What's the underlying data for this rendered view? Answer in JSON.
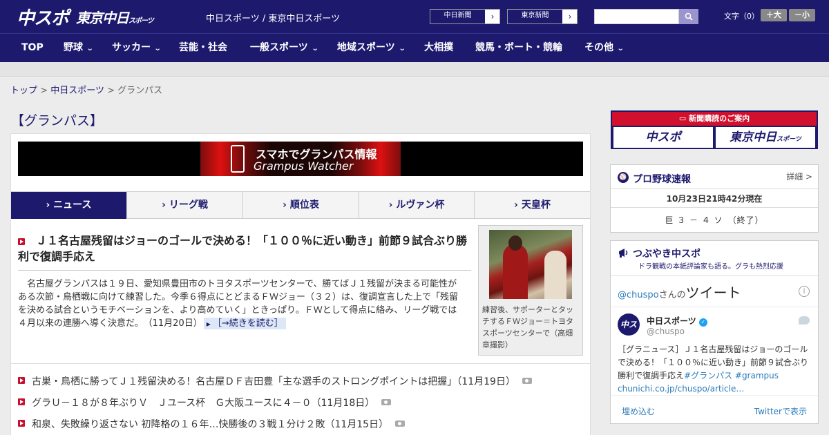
{
  "header": {
    "logo_main": "中スポ",
    "logo_tokyo": "東京中日",
    "logo_tokyo_small": "スポーツ",
    "site_links": "中日スポーツ / 東京中日スポーツ",
    "ext_links": [
      {
        "label": "中日新聞",
        "arrow": "›"
      },
      {
        "label": "東京新聞",
        "arrow": "›"
      }
    ],
    "search": {
      "placeholder": "",
      "button_icon": "search-icon"
    },
    "font_size_label": "文字（0）",
    "font_bigger": "＋大",
    "font_smaller": "－小"
  },
  "nav": {
    "items": [
      {
        "label": "TOP",
        "dropdown": false
      },
      {
        "label": "野球",
        "dropdown": true
      },
      {
        "label": "サッカー",
        "dropdown": true
      },
      {
        "label": "芸能・社会",
        "dropdown": false
      },
      {
        "label": "一般スポーツ",
        "dropdown": true
      },
      {
        "label": "地域スポーツ",
        "dropdown": true
      },
      {
        "label": "大相撲",
        "dropdown": false
      },
      {
        "label": "競馬・ボート・競輪",
        "dropdown": false
      },
      {
        "label": "その他",
        "dropdown": true
      }
    ],
    "chevron": "⌄"
  },
  "breadcrumb": {
    "home": "トップ",
    "sep": ">",
    "section": "中日スポーツ",
    "current": "グランパス"
  },
  "page_title": "【グランパス】",
  "banner": {
    "line1": "スマホでグランパス情報",
    "line2": "Grampus Watcher"
  },
  "tabs": [
    {
      "label": "ニュース",
      "active": true
    },
    {
      "label": "リーグ戦",
      "active": false
    },
    {
      "label": "順位表",
      "active": false
    },
    {
      "label": "ルヴァン杯",
      "active": false
    },
    {
      "label": "天皇杯",
      "active": false
    }
  ],
  "tab_prefix": "› ",
  "lead_article": {
    "headline": "Ｊ１名古屋残留はジョーのゴールで決める！「１００％に近い動き」前節９試合ぶり勝利で復調手応え",
    "body": "名古屋グランパスは１９日、愛知県豊田市のトヨタスポーツセンターで、勝てばＪ１残留が決まる可能性がある次節・鳥栖戦に向けて練習した。今季６得点にとどまるＦＷジョー（３２）は、復調宣言した上で「残留を決める試合というモチベーションを、より高めていく」ときっぱり。ＦＷとして得点に絡み、リーグ戦では４月以来の連勝へ導く決意だ。",
    "date": "（11月20日）",
    "read_more": "［→続きを読む］",
    "photo_caption": "練習後、サポーターとタッチするＦＷジョー＝トヨタスポーツセンターで（高畑章撮影）"
  },
  "news_list": [
    {
      "title": "古巣・鳥栖に勝ってＪ１残留決める！名古屋ＤＦ吉田豊「主な選手のストロングポイントは把握」",
      "date": "（11月19日）",
      "has_photo": true
    },
    {
      "title": "グラＵ－１８が８年ぶりＶ　Ｊユース杯　Ｇ大阪ユースに４－０",
      "date": "（11月18日）",
      "has_photo": true
    },
    {
      "title": "和泉、失敗繰り返さない 初降格の１６年…快勝後の３戦１分け２敗",
      "date": "（11月15日）",
      "has_photo": true
    }
  ],
  "sidebar": {
    "subscribe": {
      "heading": "新聞購読のご案内",
      "btn1": "中スポ",
      "btn2": "東京中日",
      "btn2_small": "スポーツ"
    },
    "baseball": {
      "title": "プロ野球速報",
      "detail_link": "詳細 >",
      "timestamp": "10月23日21時42分現在",
      "score": "巨 ３ － ４ ソ　（終了）"
    },
    "twitter": {
      "title": "つぶやき中スポ",
      "subtitle": "ドラ観戦の本紙評論家も語る。グラも熱烈応援",
      "header_handle": "@chuspo",
      "header_suffix": "さんの",
      "header_big": "ツイート",
      "info": "i",
      "account_name": "中日スポーツ",
      "verified": "✓",
      "account_handle": "@chuspo",
      "avatar_text": "中スポ",
      "tweet_text": "［グラニュース］Ｊ１名古屋残留はジョーのゴールで決める！「１００％に近い動き」前節９試合ぶり勝利で復調手応え",
      "tweet_tags": "#グランパス #grampus",
      "tweet_link": "chunichi.co.jp/chuspo/article…",
      "embed": "埋め込む",
      "view_on_twitter": "Twitterで表示"
    }
  },
  "colors": {
    "brand_navy": "#1d1a6e",
    "accent_red": "#c8102e",
    "twitter_blue": "#2b7bb9"
  }
}
